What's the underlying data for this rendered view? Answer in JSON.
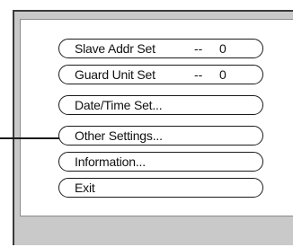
{
  "menu": {
    "items": [
      {
        "label": "Slave Addr Set",
        "dash": "--",
        "value": "0"
      },
      {
        "label": "Guard Unit Set",
        "dash": "--",
        "value": "0"
      },
      {
        "label": "Date/Time Set..."
      },
      {
        "label": "Other Settings..."
      },
      {
        "label": "Information..."
      },
      {
        "label": "Exit"
      }
    ]
  },
  "highlighted_item": "Other Settings...",
  "colors": {
    "frame": "#c9c9c9",
    "panel": "#ffffff",
    "outline": "#1a1a1a"
  }
}
